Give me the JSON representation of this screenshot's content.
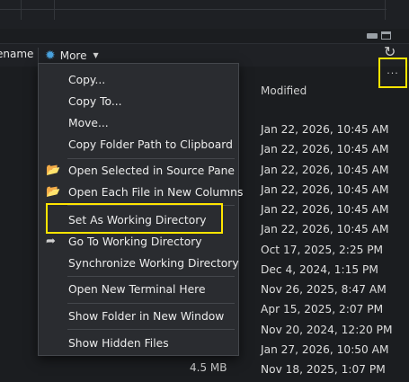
{
  "toolbar": {
    "rename_label": "ename",
    "more_label": "More",
    "more_icon": "gear-icon",
    "refresh_icon": "refresh-icon"
  },
  "header": {
    "modified_label": "Modified",
    "more_columns_label": "..."
  },
  "menu": {
    "items": [
      {
        "label": "Copy..."
      },
      {
        "label": "Copy To..."
      },
      {
        "label": "Move..."
      },
      {
        "label": "Copy Folder Path to Clipboard"
      },
      {
        "label": "Open Selected in Source Pane",
        "icon": "folder-open-icon"
      },
      {
        "label": "Open Each File in New Columns",
        "icon": "folder-open-icon"
      },
      {
        "label": "Set As Working Directory"
      },
      {
        "label": "Go To Working Directory",
        "icon": "arrow-icon"
      },
      {
        "label": "Synchronize Working Directory"
      },
      {
        "label": "Open New Terminal Here"
      },
      {
        "label": "Show Folder in New Window"
      },
      {
        "label": "Show Hidden Files"
      }
    ]
  },
  "rows": {
    "dates": [
      "Jan 22, 2026, 10:45 AM",
      "Jan 22, 2026, 10:45 AM",
      "Jan 22, 2026, 10:45 AM",
      "Jan 22, 2026, 10:45 AM",
      "Jan 22, 2026, 10:45 AM",
      "Jan 22, 2026, 10:45 AM",
      "Oct 17, 2025, 2:25 PM",
      "Dec 4, 2024, 1:15 PM",
      "Nov 26, 2025, 8:47 AM",
      "Apr 15, 2025, 2:07 PM",
      "Nov 20, 2024, 12:20 PM",
      "Jan 27, 2026, 10:50 AM",
      "Nov 18, 2025, 1:07 PM"
    ],
    "last_size": "4.5 MB"
  },
  "colors": {
    "background": "#1b1d20",
    "menu_background": "#2a2c30",
    "highlight": "#ffe500",
    "accent": "#4aa3df"
  }
}
